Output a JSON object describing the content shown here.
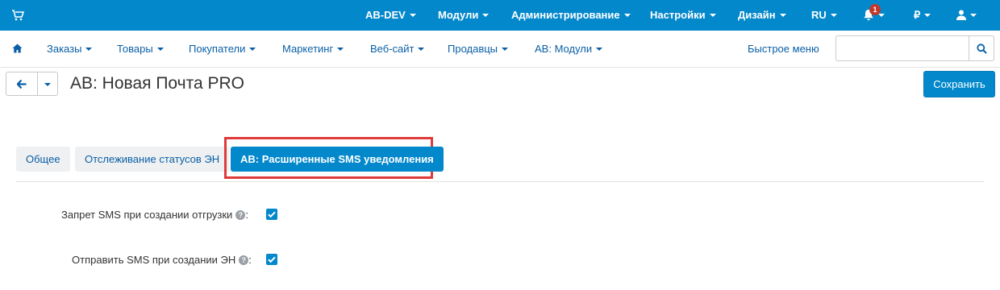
{
  "topbar": {
    "items": [
      {
        "label": "AB-DEV"
      },
      {
        "label": "Модули"
      },
      {
        "label": "Администрирование"
      },
      {
        "label": "Настройки"
      },
      {
        "label": "Дизайн"
      },
      {
        "label": "RU"
      },
      {
        "label": "₽"
      }
    ],
    "notification_count": "1"
  },
  "nav": {
    "items": [
      {
        "label": "Заказы"
      },
      {
        "label": "Товары"
      },
      {
        "label": "Покупатели"
      },
      {
        "label": "Маркетинг"
      },
      {
        "label": "Веб-сайт"
      },
      {
        "label": "Продавцы"
      },
      {
        "label": "АВ: Модули"
      }
    ],
    "quick_menu": "Быстрое меню",
    "search_value": ""
  },
  "page": {
    "title": "АВ: Новая Почта PRO",
    "save_label": "Сохранить"
  },
  "tabs": [
    {
      "label": "Общее",
      "active": false
    },
    {
      "label": "Отслеживание статусов ЭН",
      "active": false
    },
    {
      "label": "АВ: Расширенные SMS уведомления",
      "active": true
    }
  ],
  "settings": [
    {
      "label": "Запрет SMS при создании отгрузки",
      "help": "?",
      "suffix": ":",
      "checked": true
    },
    {
      "label": "Отправить SMS при создании ЭН",
      "help": "?",
      "suffix": ":",
      "checked": true
    }
  ],
  "colors": {
    "primary": "#0388cc",
    "highlight": "#e03b3b"
  }
}
